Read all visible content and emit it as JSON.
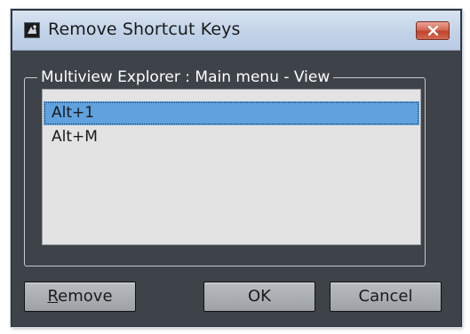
{
  "window": {
    "title": "Remove Shortcut Keys",
    "icon": "app-icon",
    "close_icon": "close-icon"
  },
  "group": {
    "label": "Multiview Explorer : Main menu - View"
  },
  "shortcuts": {
    "items": [
      {
        "label": "Alt+1",
        "selected": true
      },
      {
        "label": "Alt+M",
        "selected": false
      }
    ]
  },
  "buttons": {
    "remove_mnemonic": "R",
    "remove_rest": "emove",
    "ok_label": "OK",
    "cancel_label": "Cancel"
  },
  "colors": {
    "dialog_background": "#3e4249",
    "selection": "#5fa2dd",
    "close_button": "#c9543f"
  }
}
